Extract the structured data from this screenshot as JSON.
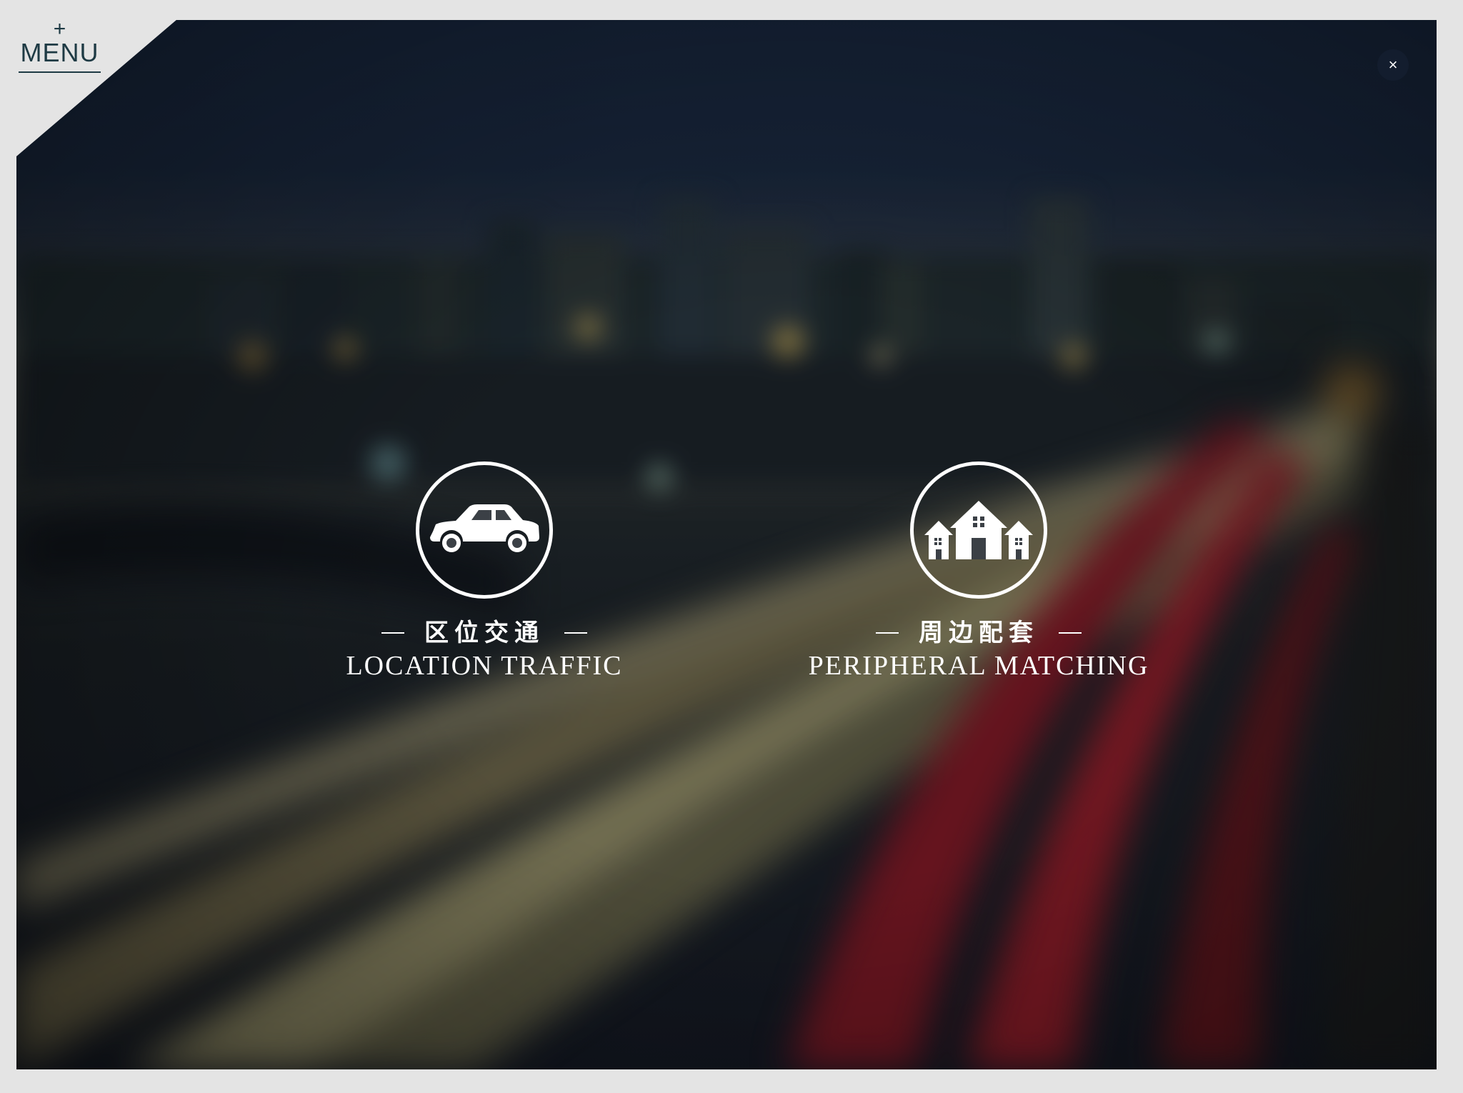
{
  "menu": {
    "plus": "+",
    "label": "MENU"
  },
  "close": {
    "symbol": "×"
  },
  "features": [
    {
      "icon": "car-icon",
      "title_cn": "区位交通",
      "title_en": "LOCATION TRAFFIC"
    },
    {
      "icon": "houses-icon",
      "title_cn": "周边配套",
      "title_en": "PERIPHERAL MATCHING"
    }
  ],
  "colors": {
    "menu_text": "#1e3a44",
    "page_bg": "#e4e4e4",
    "icon_white": "#ffffff"
  }
}
